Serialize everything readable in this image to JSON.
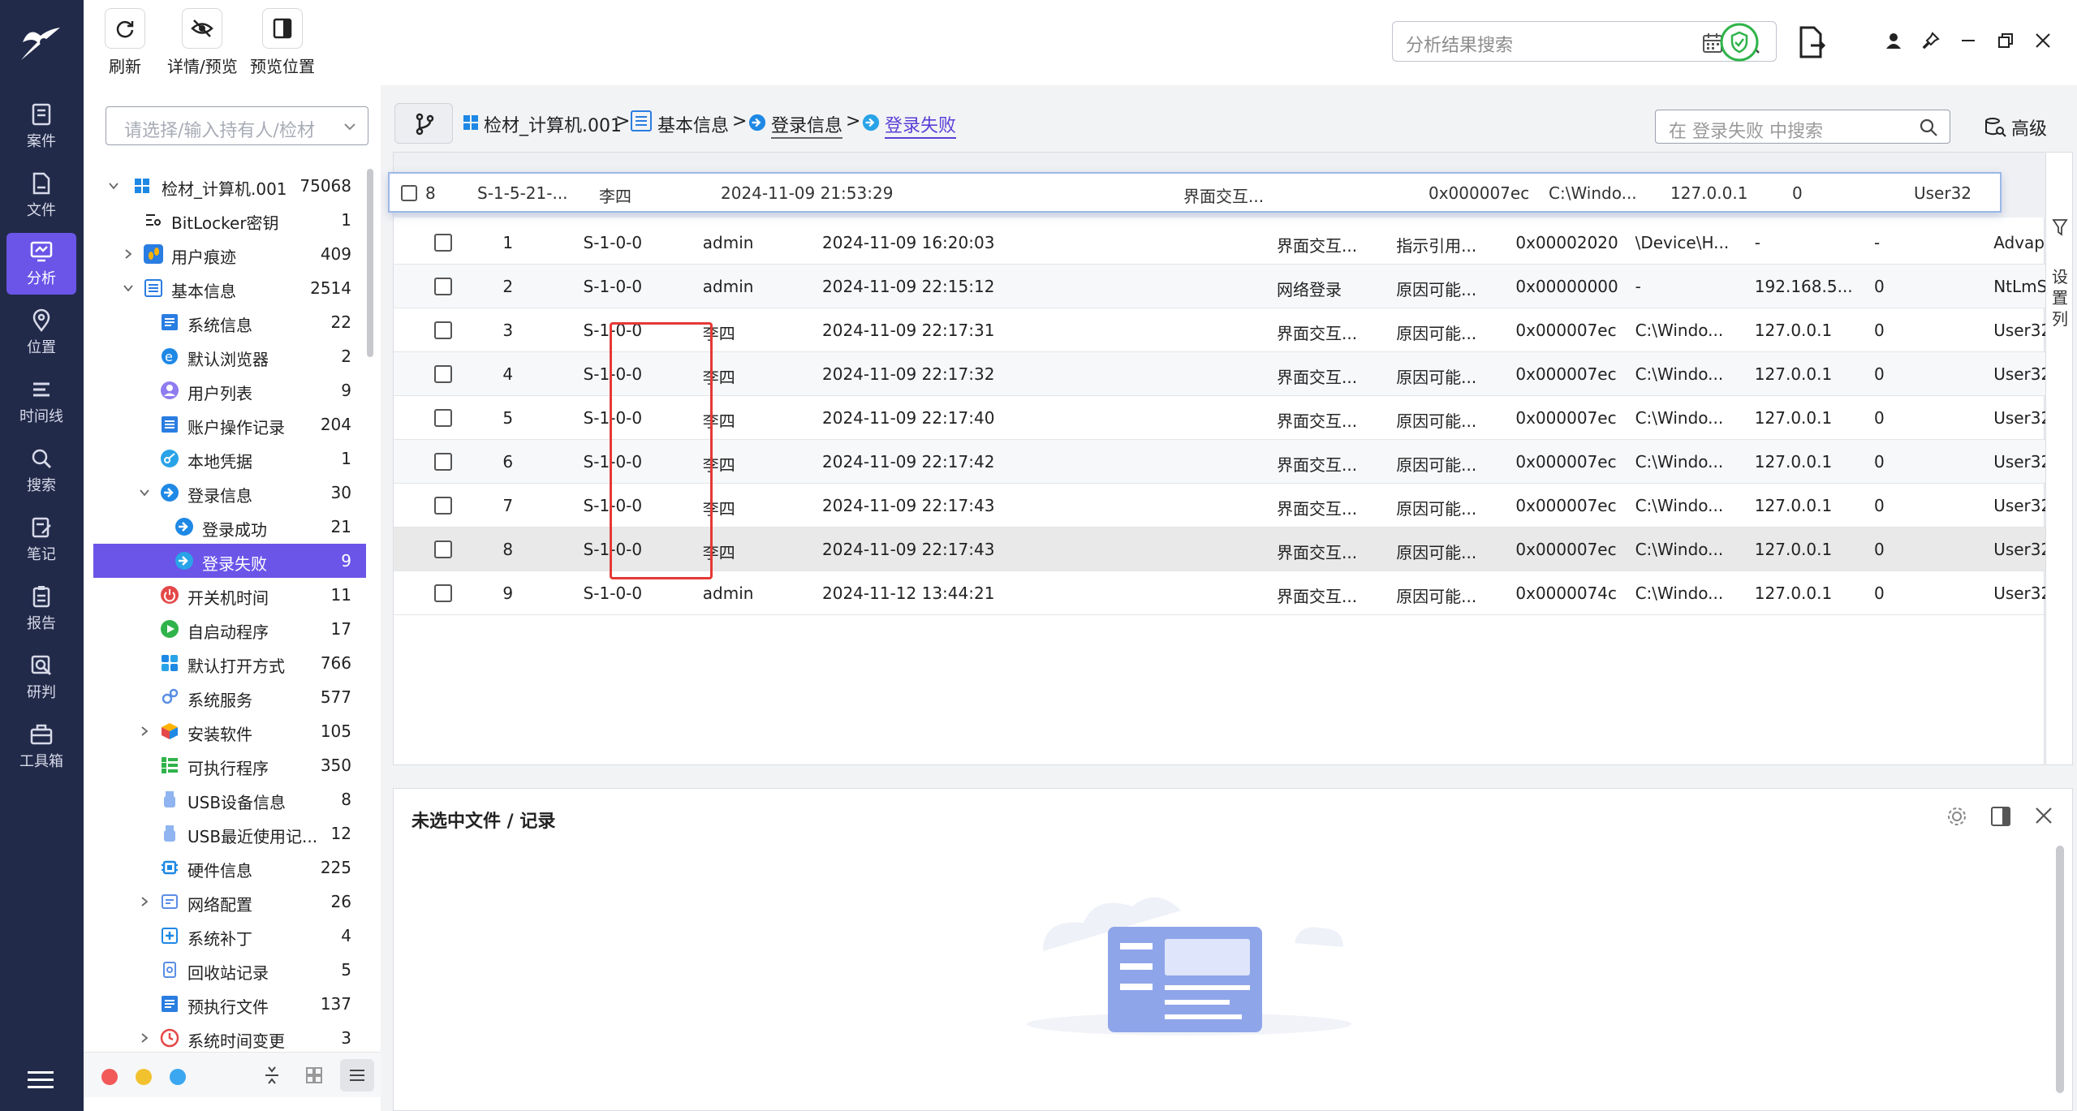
{
  "toolbar": {
    "refresh": "刷新",
    "detail_preview": "详情/预览",
    "preview_position": "预览位置",
    "search_placeholder": "分析结果搜索"
  },
  "nav": {
    "items": [
      {
        "label": "案件",
        "icon": "case-icon"
      },
      {
        "label": "文件",
        "icon": "file-icon"
      },
      {
        "label": "分析",
        "icon": "analysis-icon"
      },
      {
        "label": "位置",
        "icon": "location-icon"
      },
      {
        "label": "时间线",
        "icon": "timeline-icon"
      },
      {
        "label": "搜索",
        "icon": "search-icon"
      },
      {
        "label": "笔记",
        "icon": "note-icon"
      },
      {
        "label": "报告",
        "icon": "report-icon"
      },
      {
        "label": "研判",
        "icon": "judge-icon"
      },
      {
        "label": "工具箱",
        "icon": "toolbox-icon"
      }
    ],
    "active": "分析"
  },
  "tree": {
    "search_placeholder": "请选择/输入持有人/检材",
    "items": [
      {
        "label": "检材_计算机.001",
        "count": "75068"
      },
      {
        "label": "BitLocker密钥",
        "count": "1"
      },
      {
        "label": "用户痕迹",
        "count": "409"
      },
      {
        "label": "基本信息",
        "count": "2514"
      },
      {
        "label": "系统信息",
        "count": "22"
      },
      {
        "label": "默认浏览器",
        "count": "2"
      },
      {
        "label": "用户列表",
        "count": "9"
      },
      {
        "label": "账户操作记录",
        "count": "204"
      },
      {
        "label": "本地凭据",
        "count": "1"
      },
      {
        "label": "登录信息",
        "count": "30"
      },
      {
        "label": "登录成功",
        "count": "21"
      },
      {
        "label": "登录失败",
        "count": "9"
      },
      {
        "label": "开关机时间",
        "count": "11"
      },
      {
        "label": "自启动程序",
        "count": "17"
      },
      {
        "label": "默认打开方式",
        "count": "766"
      },
      {
        "label": "系统服务",
        "count": "577"
      },
      {
        "label": "安装软件",
        "count": "105"
      },
      {
        "label": "可执行程序",
        "count": "350"
      },
      {
        "label": "USB设备信息",
        "count": "8"
      },
      {
        "label": "USB最近使用记...",
        "count": "12"
      },
      {
        "label": "硬件信息",
        "count": "225"
      },
      {
        "label": "网络配置",
        "count": "26"
      },
      {
        "label": "系统补丁",
        "count": "4"
      },
      {
        "label": "回收站记录",
        "count": "5"
      },
      {
        "label": "预执行文件",
        "count": "137"
      },
      {
        "label": "系统时间变更",
        "count": "3"
      }
    ]
  },
  "breadcrumb": {
    "c1": "检材_计算机.001",
    "c2": "基本信息",
    "c3": "登录信息",
    "c4": "登录失败",
    "sep": ">"
  },
  "list_search_placeholder": "在 登录失败 中搜索",
  "advanced": "高级",
  "side_label": "设置列",
  "floating_row": {
    "idx": "8",
    "sid": "S-1-5-21-...",
    "user": "李四",
    "time": "2024-11-09 21:53:29",
    "type": "界面交互...",
    "pid": "0x000007ec",
    "proc": "C:\\Windo...",
    "ip": "127.0.0.1",
    "port": "0",
    "pkg": "User32"
  },
  "rows": [
    {
      "idx": "1",
      "sid": "S-1-0-0",
      "user": "admin",
      "time": "2024-11-09 16:20:03",
      "type": "界面交互...",
      "reason": "指示引用...",
      "pid": "0x00002020",
      "proc": "\\Device\\H...",
      "ip": "-",
      "port": "-",
      "pkg": "Advapi"
    },
    {
      "idx": "2",
      "sid": "S-1-0-0",
      "user": "admin",
      "time": "2024-11-09 22:15:12",
      "type": "网络登录",
      "reason": "原因可能...",
      "pid": "0x00000000",
      "proc": "-",
      "ip": "192.168.5...",
      "port": "0",
      "pkg": "NtLmSsp"
    },
    {
      "idx": "3",
      "sid": "S-1-0-0",
      "user": "李四",
      "time": "2024-11-09 22:17:31",
      "type": "界面交互...",
      "reason": "原因可能...",
      "pid": "0x000007ec",
      "proc": "C:\\Windo...",
      "ip": "127.0.0.1",
      "port": "0",
      "pkg": "User32"
    },
    {
      "idx": "4",
      "sid": "S-1-0-0",
      "user": "李四",
      "time": "2024-11-09 22:17:32",
      "type": "界面交互...",
      "reason": "原因可能...",
      "pid": "0x000007ec",
      "proc": "C:\\Windo...",
      "ip": "127.0.0.1",
      "port": "0",
      "pkg": "User32"
    },
    {
      "idx": "5",
      "sid": "S-1-0-0",
      "user": "李四",
      "time": "2024-11-09 22:17:40",
      "type": "界面交互...",
      "reason": "原因可能...",
      "pid": "0x000007ec",
      "proc": "C:\\Windo...",
      "ip": "127.0.0.1",
      "port": "0",
      "pkg": "User32"
    },
    {
      "idx": "6",
      "sid": "S-1-0-0",
      "user": "李四",
      "time": "2024-11-09 22:17:42",
      "type": "界面交互...",
      "reason": "原因可能...",
      "pid": "0x000007ec",
      "proc": "C:\\Windo...",
      "ip": "127.0.0.1",
      "port": "0",
      "pkg": "User32"
    },
    {
      "idx": "7",
      "sid": "S-1-0-0",
      "user": "李四",
      "time": "2024-11-09 22:17:43",
      "type": "界面交互...",
      "reason": "原因可能...",
      "pid": "0x000007ec",
      "proc": "C:\\Windo...",
      "ip": "127.0.0.1",
      "port": "0",
      "pkg": "User32"
    },
    {
      "idx": "8",
      "sid": "S-1-0-0",
      "user": "李四",
      "time": "2024-11-09 22:17:43",
      "type": "界面交互...",
      "reason": "原因可能...",
      "pid": "0x000007ec",
      "proc": "C:\\Windo...",
      "ip": "127.0.0.1",
      "port": "0",
      "pkg": "User32"
    },
    {
      "idx": "9",
      "sid": "S-1-0-0",
      "user": "admin",
      "time": "2024-11-12 13:44:21",
      "type": "界面交互...",
      "reason": "原因可能...",
      "pid": "0x0000074c",
      "proc": "C:\\Windo...",
      "ip": "127.0.0.1",
      "port": "0",
      "pkg": "User32"
    }
  ],
  "detail": {
    "title": "未选中文件 / 记录"
  },
  "colors": {
    "accent": "#6a55e8",
    "nav_bg": "#222a4a",
    "highlight_box": "#e53935",
    "shield": "#2fb34a"
  }
}
